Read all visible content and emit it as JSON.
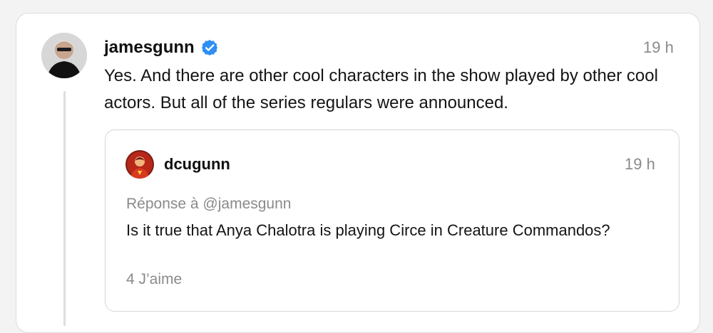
{
  "post": {
    "username": "jamesgunn",
    "time": "19 h",
    "text": "Yes. And there are other cool characters in the show played by other cool actors. But all of the series regulars were announced.",
    "verified_color": "#2f8ff3"
  },
  "quoted_post": {
    "username": "dcugunn",
    "time": "19 h",
    "reply_to": "Réponse à @jamesgunn",
    "text": "Is it true that Anya Chalotra is playing Circe in Creature Commandos?",
    "likes": "4 J’aime"
  },
  "icons": {
    "verified": "verified-badge-icon",
    "avatar_main": "user-avatar",
    "avatar_quote": "user-avatar"
  }
}
